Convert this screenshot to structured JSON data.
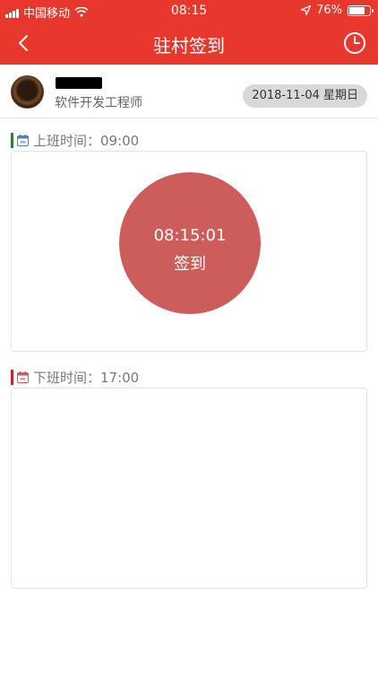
{
  "status_bar": {
    "carrier": "中国移动",
    "time": "08:15",
    "battery": "76%",
    "battery_level": 0.76
  },
  "nav": {
    "title": "驻村签到"
  },
  "profile": {
    "job_title": "软件开发工程师",
    "date": "2018-11-04 星期日"
  },
  "work_start": {
    "label": "上班时间：09:00",
    "accent": "#2e7d32",
    "button_time": "08:15:01",
    "button_label": "签到"
  },
  "work_end": {
    "label": "下班时间：17:00",
    "accent": "#c62828"
  },
  "colors": {
    "brand": "#e8382d",
    "checkin_button": "#cd5d5a"
  }
}
